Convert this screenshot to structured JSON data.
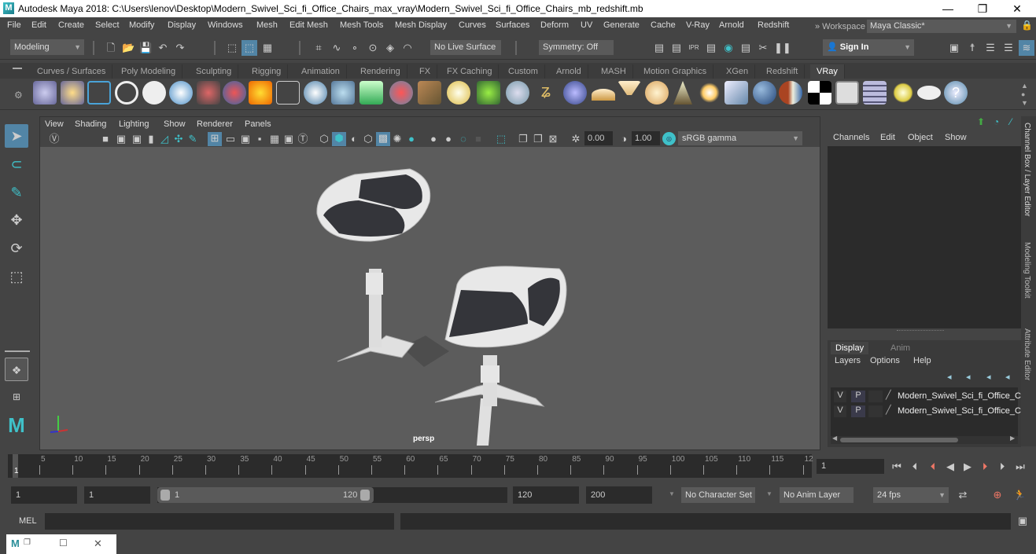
{
  "window": {
    "title": "Autodesk Maya 2018: C:\\Users\\lenov\\Desktop\\Modern_Swivel_Sci_fi_Office_Chairs_max_vray\\Modern_Swivel_Sci_fi_Office_Chairs_mb_redshift.mb",
    "logo": "M",
    "minimize": "—",
    "restore": "❐",
    "close": "✕"
  },
  "menubar": {
    "items": [
      "File",
      "Edit",
      "Create",
      "Select",
      "Modify",
      "Display",
      "Windows",
      "Mesh",
      "Edit Mesh",
      "Mesh Tools",
      "Mesh Display",
      "Curves",
      "Surfaces",
      "Deform",
      "UV",
      "Generate",
      "Cache",
      "V-Ray",
      "Arnold",
      "Redshift"
    ],
    "workspace_label": "» Workspace :",
    "workspace_value": "Maya Classic*",
    "lock_icon": "🔒"
  },
  "statusline": {
    "mode": "Modeling",
    "live_surface": "No Live Surface",
    "symmetry": "Symmetry: Off",
    "sign_in": "Sign In"
  },
  "shelf": {
    "tabs": [
      "Curves / Surfaces",
      "Poly Modeling",
      "Sculpting",
      "Rigging",
      "Animation",
      "Rendering",
      "FX",
      "FX Caching",
      "Custom",
      "Arnold",
      "MASH",
      "Motion Graphics",
      "XGen",
      "Redshift",
      "VRay"
    ],
    "active_tab": "VRay",
    "icons": [
      "vray-save-icon",
      "vray-load-icon",
      "vray-settings-icon",
      "vray-logo-icon",
      "vray-file-icon",
      "vray-material-icon",
      "vray-camera-icon",
      "vray-spheres-icon",
      "vray-fire-icon",
      "vray-plane-icon",
      "vray-box-icon",
      "vray-cone-icon",
      "vray-light-icon",
      "vray-fur-icon",
      "vray-texture-icon",
      "vray-dome-icon",
      "vray-grass-icon",
      "vray-flake-icon",
      "vray-curve-icon",
      "vray-sphere-icon",
      "vray-dome-light-icon",
      "vray-spot-icon",
      "vray-orb-icon",
      "vray-ies-icon",
      "vray-sun-icon",
      "vray-sky-icon",
      "vray-ball-icon",
      "vray-split-icon",
      "vray-checker-icon",
      "vray-framebuffer-icon",
      "vray-table-icon",
      "vray-bulb-icon",
      "vray-cloud-icon",
      "vray-help-icon"
    ]
  },
  "viewport": {
    "menu": [
      "View",
      "Shading",
      "Lighting",
      "Show",
      "Renderer",
      "Panels"
    ],
    "exposure": "0.00",
    "gamma": "1.00",
    "color_space": "sRGB gamma",
    "camera_label": "persp"
  },
  "channelbox": {
    "menu": [
      "Channels",
      "Edit",
      "Object",
      "Show"
    ]
  },
  "layereditor": {
    "tabs": [
      "Display",
      "Anim"
    ],
    "active_tab": "Display",
    "menu": [
      "Layers",
      "Options",
      "Help"
    ],
    "layers": [
      {
        "v": "V",
        "p": "P",
        "name": "Modern_Swivel_Sci_fi_Office_C"
      },
      {
        "v": "V",
        "p": "P",
        "name": "Modern_Swivel_Sci_fi_Office_C"
      }
    ]
  },
  "sidetabs": [
    "Channel Box / Layer Editor",
    "Modeling Toolkit",
    "Attribute Editor"
  ],
  "timeline": {
    "ticks": [
      "5",
      "10",
      "15",
      "20",
      "25",
      "30",
      "35",
      "40",
      "45",
      "50",
      "55",
      "60",
      "65",
      "70",
      "75",
      "80",
      "85",
      "90",
      "95",
      "100",
      "105",
      "110",
      "115",
      "12"
    ],
    "current_frame_marker": "1",
    "current_frame": "1"
  },
  "range": {
    "start": "1",
    "playback_start": "1",
    "slider_start": "1",
    "slider_end": "120",
    "playback_end": "120",
    "end": "200",
    "character_set": "No Character Set",
    "anim_layer": "No Anim Layer",
    "fps": "24 fps"
  },
  "commandline": {
    "label": "MEL"
  },
  "taskbar": {
    "logo": "M"
  }
}
